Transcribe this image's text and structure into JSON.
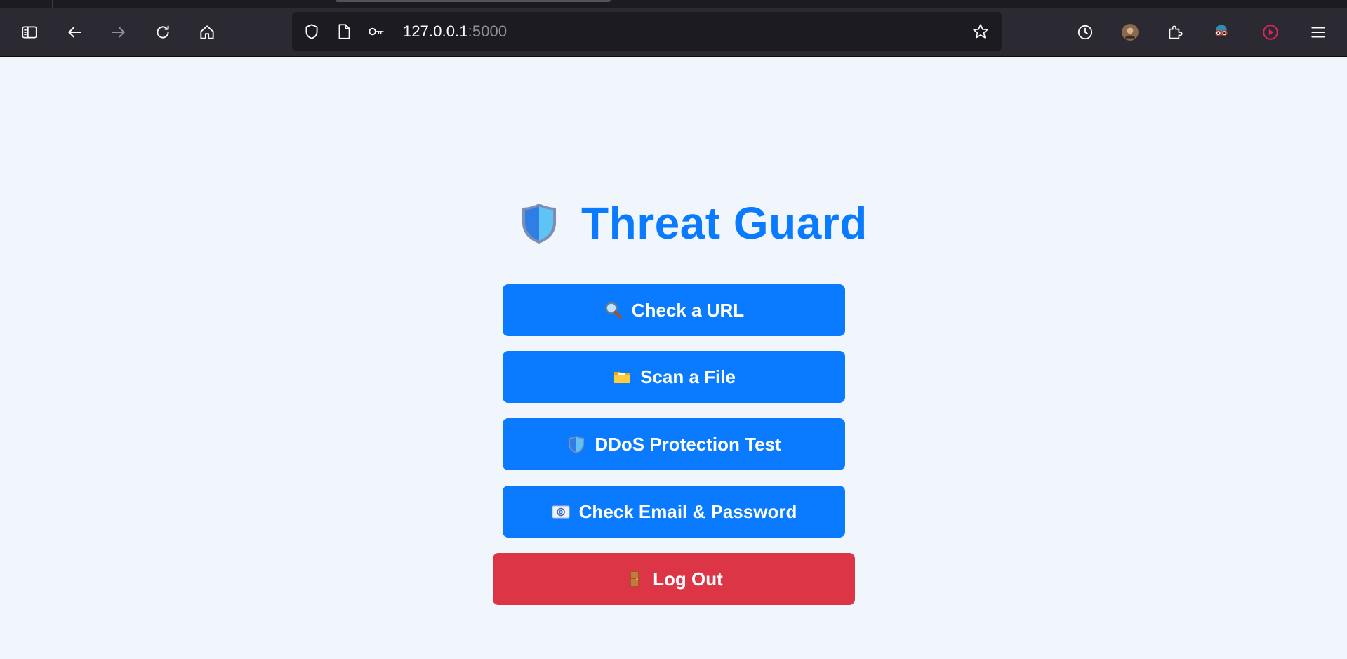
{
  "browser": {
    "url_host": "127.0.0.1",
    "url_port": ":5000",
    "toolbar_icons": [
      "sidebar-icon",
      "back-arrow-icon",
      "forward-arrow-icon",
      "reload-icon",
      "home-icon",
      "shield-icon",
      "page-icon",
      "key-icon",
      "star-icon",
      "history-clock-icon",
      "account-avatar-icon",
      "extensions-puzzle-icon",
      "extension-glasses-icon",
      "extension-play-icon",
      "hamburger-menu-icon"
    ]
  },
  "page": {
    "title": "Threat Guard",
    "buttons": [
      {
        "label": "Check a URL",
        "icon": "magnifier-icon",
        "color": "#0a7bff"
      },
      {
        "label": "Scan a File",
        "icon": "folder-icon",
        "color": "#0a7bff"
      },
      {
        "label": "DDoS Protection Test",
        "icon": "shield-icon",
        "color": "#0a7bff"
      },
      {
        "label": "Check Email & Password",
        "icon": "email-icon",
        "color": "#0a7bff"
      },
      {
        "label": "Log Out",
        "icon": "door-icon",
        "color": "#dc3545"
      }
    ]
  },
  "colors": {
    "accent": "#0a7bff",
    "danger": "#dc3545",
    "page_background": "#f0f6fc",
    "toolbar_background": "#2b2a33"
  }
}
